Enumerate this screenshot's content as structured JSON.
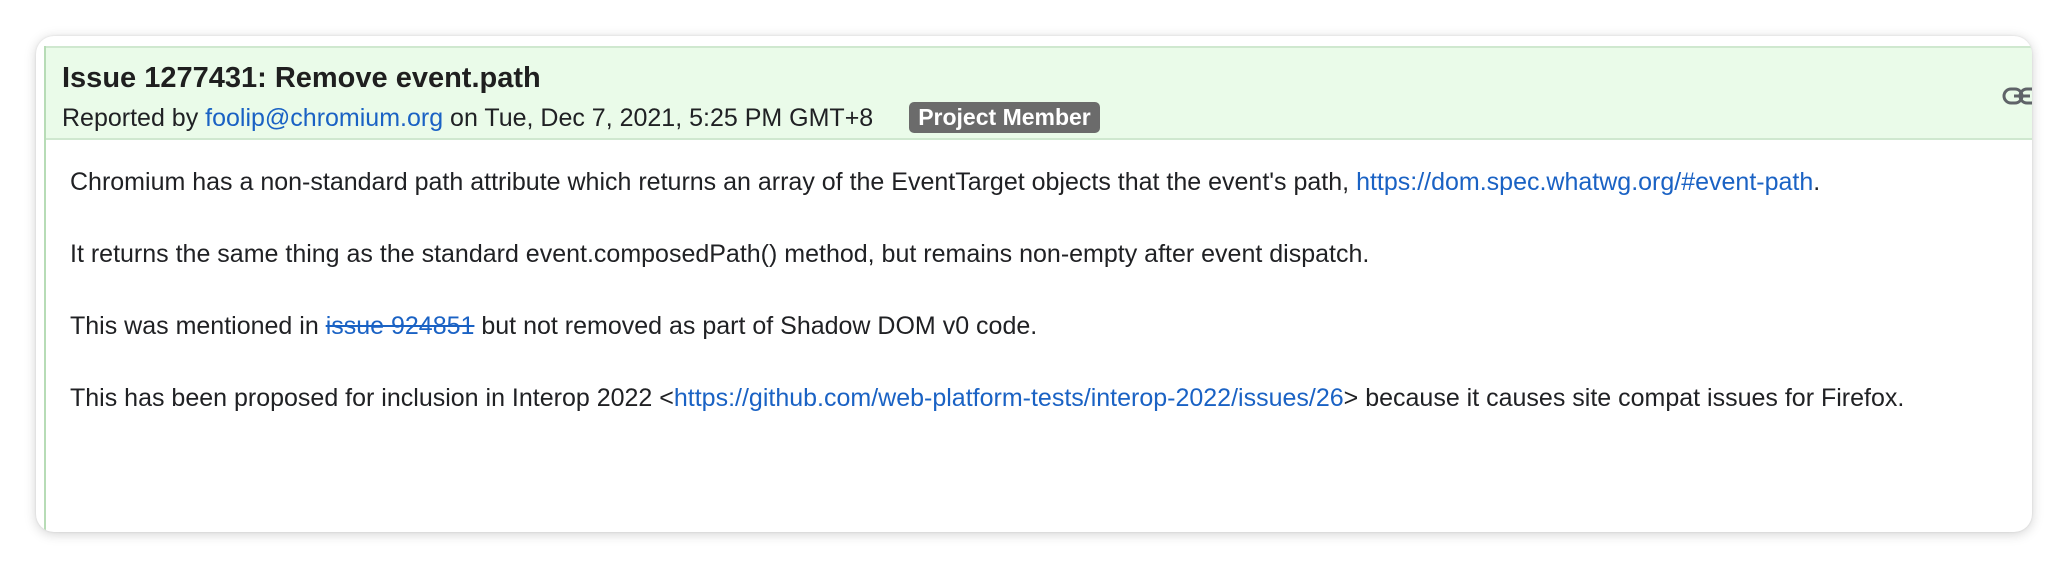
{
  "issue": {
    "title": "Issue 1277431: Remove event.path",
    "reported_by_prefix": "Reported by ",
    "reporter": "foolip@chromium.org",
    "date_text": " on Tue, Dec 7, 2021, 5:25 PM GMT+8",
    "role_badge": "Project Member",
    "icons": {
      "permalink": "link-icon"
    }
  },
  "description": {
    "p1_text": "Chromium has a non-standard path attribute which returns an array of the EventTarget objects that the event's path, ",
    "p1_link": "https://dom.spec.whatwg.org/#event-path",
    "p1_end": ".",
    "p2_text": "It returns the same thing as the standard event.composedPath() method, but remains non-empty after event dispatch.",
    "p3_before": "This was mentioned in ",
    "p3_link": "issue 924851",
    "p3_after": " but not removed as part of Shadow DOM v0 code.",
    "p4_before": "This has been proposed for inclusion in Interop 2022 <",
    "p4_link": "https://github.com/web-platform-tests/interop-2022/issues/26",
    "p4_after": "> because it causes site compat issues for Firefox."
  },
  "colors": {
    "header_bg": "#eafbe9",
    "link": "#1a62c4",
    "badge_bg": "#6b6b6b"
  }
}
